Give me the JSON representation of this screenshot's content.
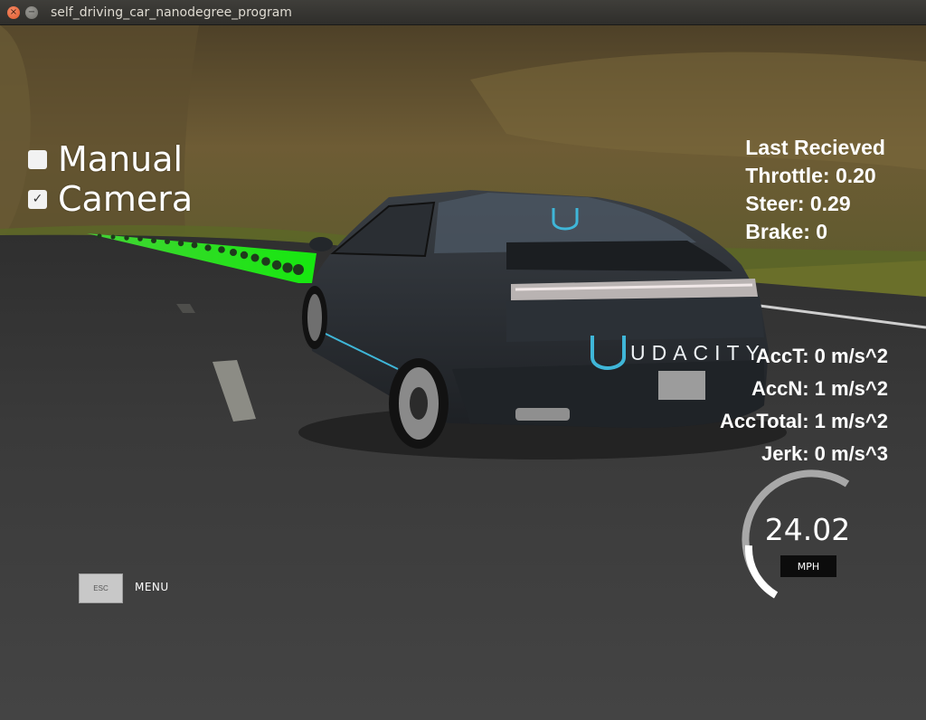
{
  "window": {
    "title": "self_driving_car_nanodegree_program",
    "close_glyph": "×",
    "minimize_glyph": "−"
  },
  "toggles": {
    "manual": {
      "label": "Manual",
      "checked": false
    },
    "camera": {
      "label": "Camera",
      "checked": true,
      "check_glyph": "✓"
    }
  },
  "telemetry": {
    "header": "Last Recieved",
    "throttle": "Throttle: 0.20",
    "steer": "Steer: 0.29",
    "brake": "Brake: 0"
  },
  "acceleration": {
    "acc_t": "AccT: 0 m/s^2",
    "acc_n": "AccN: 1 m/s^2",
    "acc_total": "AccTotal: 1 m/s^2",
    "jerk": "Jerk: 0 m/s^3"
  },
  "speedometer": {
    "value": "24.02",
    "unit": "MPH"
  },
  "menu": {
    "esc_label": "ESC",
    "menu_label": "MENU"
  },
  "car": {
    "brand_text": "UDACITY"
  },
  "colors": {
    "path_green": "#22d41a",
    "road": "#3b3b3b",
    "hill": "#6b5a33",
    "car_body": "#272b30",
    "brand_cyan": "#3fb6d8"
  }
}
